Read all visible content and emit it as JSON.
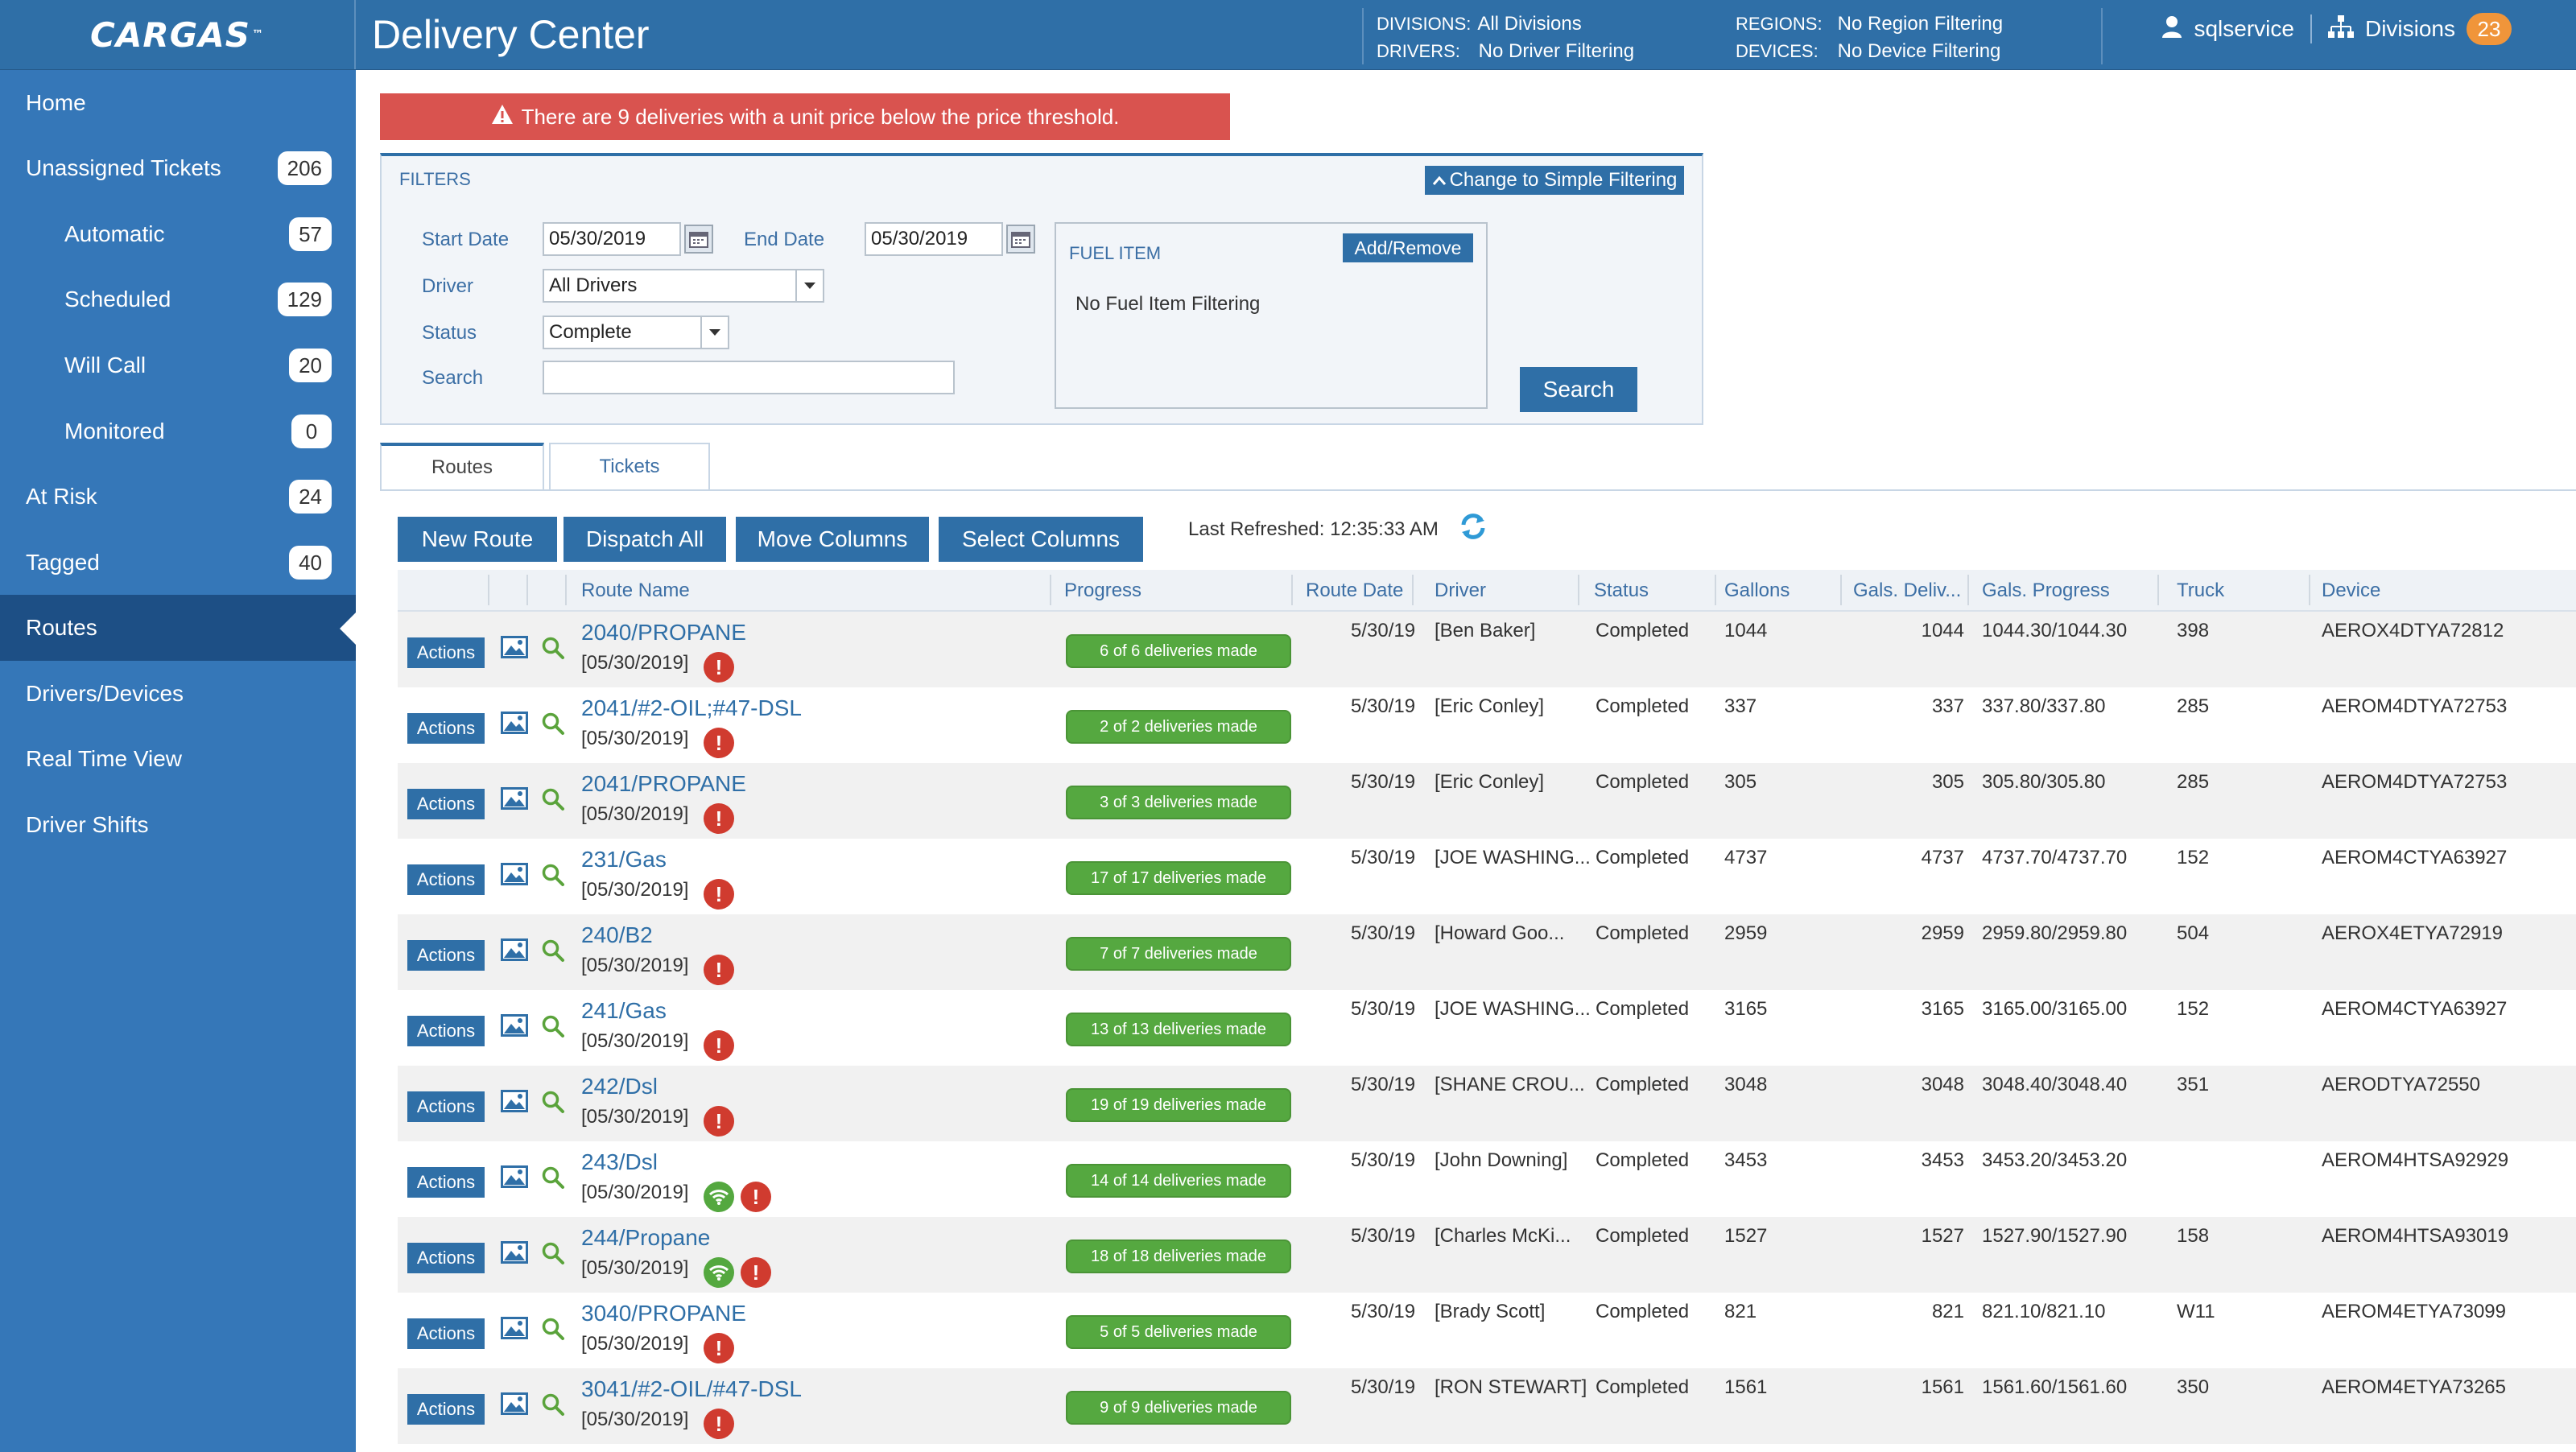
{
  "app": {
    "logo": "CARGAS",
    "title": "Delivery Center"
  },
  "header": {
    "divisions_label": "DIVISIONS:",
    "divisions_value": "All Divisions",
    "drivers_label": "DRIVERS:",
    "drivers_value": "No Driver Filtering",
    "regions_label": "REGIONS:",
    "regions_value": "No Region Filtering",
    "devices_label": "DEVICES:",
    "devices_value": "No Device Filtering",
    "user": "sqlservice",
    "divisions_menu": "Divisions",
    "divisions_count": "23"
  },
  "sidebar": {
    "items": [
      {
        "label": "Home",
        "count": ""
      },
      {
        "label": "Unassigned Tickets",
        "count": "206"
      },
      {
        "label": "Automatic",
        "count": "57"
      },
      {
        "label": "Scheduled",
        "count": "129"
      },
      {
        "label": "Will Call",
        "count": "20"
      },
      {
        "label": "Monitored",
        "count": "0"
      },
      {
        "label": "At Risk",
        "count": "24"
      },
      {
        "label": "Tagged",
        "count": "40"
      },
      {
        "label": "Routes",
        "count": ""
      },
      {
        "label": "Drivers/Devices",
        "count": ""
      },
      {
        "label": "Real Time View",
        "count": ""
      },
      {
        "label": "Driver Shifts",
        "count": ""
      }
    ]
  },
  "alert": {
    "text": "There are 9 deliveries with a unit price below the price threshold."
  },
  "filters": {
    "title": "FILTERS",
    "toggle_label": "Change to Simple Filtering",
    "start_date_label": "Start Date",
    "start_date": "05/30/2019",
    "end_date_label": "End Date",
    "end_date": "05/30/2019",
    "driver_label": "Driver",
    "driver_value": "All Drivers",
    "status_label": "Status",
    "status_value": "Complete",
    "search_label": "Search",
    "search_value": "",
    "fuel_title": "FUEL ITEM",
    "fuel_button": "Add/Remove",
    "fuel_value": "No Fuel Item Filtering",
    "search_button": "Search"
  },
  "tabs": {
    "routes": "Routes",
    "tickets": "Tickets"
  },
  "toolbar": {
    "new_route": "New Route",
    "dispatch_all": "Dispatch All",
    "move_columns": "Move Columns",
    "select_columns": "Select Columns",
    "last_refreshed": "Last Refreshed: 12:35:33 AM"
  },
  "table": {
    "columns": [
      "Route Name",
      "Progress",
      "Route Date",
      "Driver",
      "Status",
      "Gallons",
      "Gals. Deliv...",
      "Gals. Progress",
      "Truck",
      "Device"
    ],
    "actions_label": "Actions",
    "rows": [
      {
        "name": "2040/PROPANE",
        "sub": "[05/30/2019]",
        "wifi": false,
        "progress": "6 of 6 deliveries made",
        "route_date": "5/30/19",
        "driver": "[Ben Baker]",
        "status": "Completed",
        "gallons": "1044",
        "delivered": "1044",
        "gals_progress": "1044.30/1044.30",
        "truck": "398",
        "device": "AEROX4DTYA72812"
      },
      {
        "name": "2041/#2-OIL;#47-DSL",
        "sub": "[05/30/2019]",
        "wifi": false,
        "progress": "2 of 2 deliveries made",
        "route_date": "5/30/19",
        "driver": "[Eric Conley]",
        "status": "Completed",
        "gallons": "337",
        "delivered": "337",
        "gals_progress": "337.80/337.80",
        "truck": "285",
        "device": "AEROM4DTYA72753"
      },
      {
        "name": "2041/PROPANE",
        "sub": "[05/30/2019]",
        "wifi": false,
        "progress": "3 of 3 deliveries made",
        "route_date": "5/30/19",
        "driver": "[Eric Conley]",
        "status": "Completed",
        "gallons": "305",
        "delivered": "305",
        "gals_progress": "305.80/305.80",
        "truck": "285",
        "device": "AEROM4DTYA72753"
      },
      {
        "name": "231/Gas",
        "sub": "[05/30/2019]",
        "wifi": false,
        "progress": "17 of 17 deliveries made",
        "route_date": "5/30/19",
        "driver": "[JOE WASHING...",
        "status": "Completed",
        "gallons": "4737",
        "delivered": "4737",
        "gals_progress": "4737.70/4737.70",
        "truck": "152",
        "device": "AEROM4CTYA63927"
      },
      {
        "name": "240/B2",
        "sub": "[05/30/2019]",
        "wifi": false,
        "progress": "7 of 7 deliveries made",
        "route_date": "5/30/19",
        "driver": "[Howard Goo...",
        "status": "Completed",
        "gallons": "2959",
        "delivered": "2959",
        "gals_progress": "2959.80/2959.80",
        "truck": "504",
        "device": "AEROX4ETYA72919"
      },
      {
        "name": "241/Gas",
        "sub": "[05/30/2019]",
        "wifi": false,
        "progress": "13 of 13 deliveries made",
        "route_date": "5/30/19",
        "driver": "[JOE WASHING...",
        "status": "Completed",
        "gallons": "3165",
        "delivered": "3165",
        "gals_progress": "3165.00/3165.00",
        "truck": "152",
        "device": "AEROM4CTYA63927"
      },
      {
        "name": "242/Dsl",
        "sub": "[05/30/2019]",
        "wifi": false,
        "progress": "19 of 19 deliveries made",
        "route_date": "5/30/19",
        "driver": "[SHANE CROU...",
        "status": "Completed",
        "gallons": "3048",
        "delivered": "3048",
        "gals_progress": "3048.40/3048.40",
        "truck": "351",
        "device": "AERODTYA72550"
      },
      {
        "name": "243/Dsl",
        "sub": "[05/30/2019]",
        "wifi": true,
        "progress": "14 of 14 deliveries made",
        "route_date": "5/30/19",
        "driver": "[John Downing]",
        "status": "Completed",
        "gallons": "3453",
        "delivered": "3453",
        "gals_progress": "3453.20/3453.20",
        "truck": "",
        "device": "AEROM4HTSA92929"
      },
      {
        "name": "244/Propane",
        "sub": "[05/30/2019]",
        "wifi": true,
        "progress": "18 of 18 deliveries made",
        "route_date": "5/30/19",
        "driver": "[Charles McKi...",
        "status": "Completed",
        "gallons": "1527",
        "delivered": "1527",
        "gals_progress": "1527.90/1527.90",
        "truck": "158",
        "device": "AEROM4HTSA93019"
      },
      {
        "name": "3040/PROPANE",
        "sub": "[05/30/2019]",
        "wifi": false,
        "progress": "5 of 5 deliveries made",
        "route_date": "5/30/19",
        "driver": "[Brady Scott]",
        "status": "Completed",
        "gallons": "821",
        "delivered": "821",
        "gals_progress": "821.10/821.10",
        "truck": "W11",
        "device": "AEROM4ETYA73099"
      },
      {
        "name": "3041/#2-OIL/#47-DSL",
        "sub": "[05/30/2019]",
        "wifi": false,
        "progress": "9 of 9 deliveries made",
        "route_date": "5/30/19",
        "driver": "[RON STEWART]",
        "status": "Completed",
        "gallons": "1561",
        "delivered": "1561",
        "gals_progress": "1561.60/1561.60",
        "truck": "350",
        "device": "AEROM4ETYA73265"
      }
    ]
  }
}
